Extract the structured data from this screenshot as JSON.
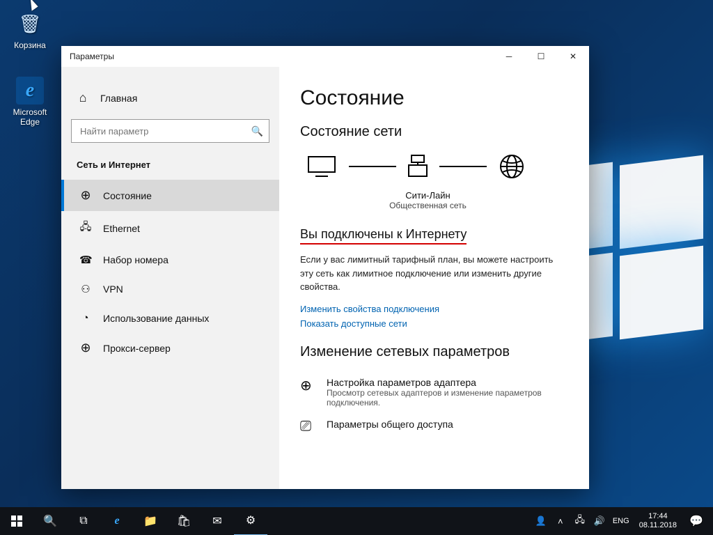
{
  "desktop": {
    "recycle_label": "Корзина",
    "edge_label": "Microsoft Edge"
  },
  "window": {
    "title": "Параметры"
  },
  "sidebar": {
    "home": "Главная",
    "search_placeholder": "Найти параметр",
    "section": "Сеть и Интернет",
    "items": [
      {
        "label": "Состояние"
      },
      {
        "label": "Ethernet"
      },
      {
        "label": "Набор номера"
      },
      {
        "label": "VPN"
      },
      {
        "label": "Использование данных"
      },
      {
        "label": "Прокси-сервер"
      }
    ]
  },
  "content": {
    "title": "Состояние",
    "net_header": "Состояние сети",
    "net_name": "Сити-Лайн",
    "net_type": "Общественная сеть",
    "connected_heading": "Вы подключены к Интернету",
    "connected_body": "Если у вас лимитный тарифный план, вы можете настроить эту сеть как лимитное подключение или изменить другие свойства.",
    "link_props": "Изменить свойства подключения",
    "link_show": "Показать доступные сети",
    "change_header": "Изменение сетевых параметров",
    "adapter_title": "Настройка параметров адаптера",
    "adapter_desc": "Просмотр сетевых адаптеров и изменение параметров подключения.",
    "sharing_title": "Параметры общего доступа"
  },
  "taskbar": {
    "lang": "ENG",
    "time": "17:44",
    "date": "08.11.2018"
  }
}
